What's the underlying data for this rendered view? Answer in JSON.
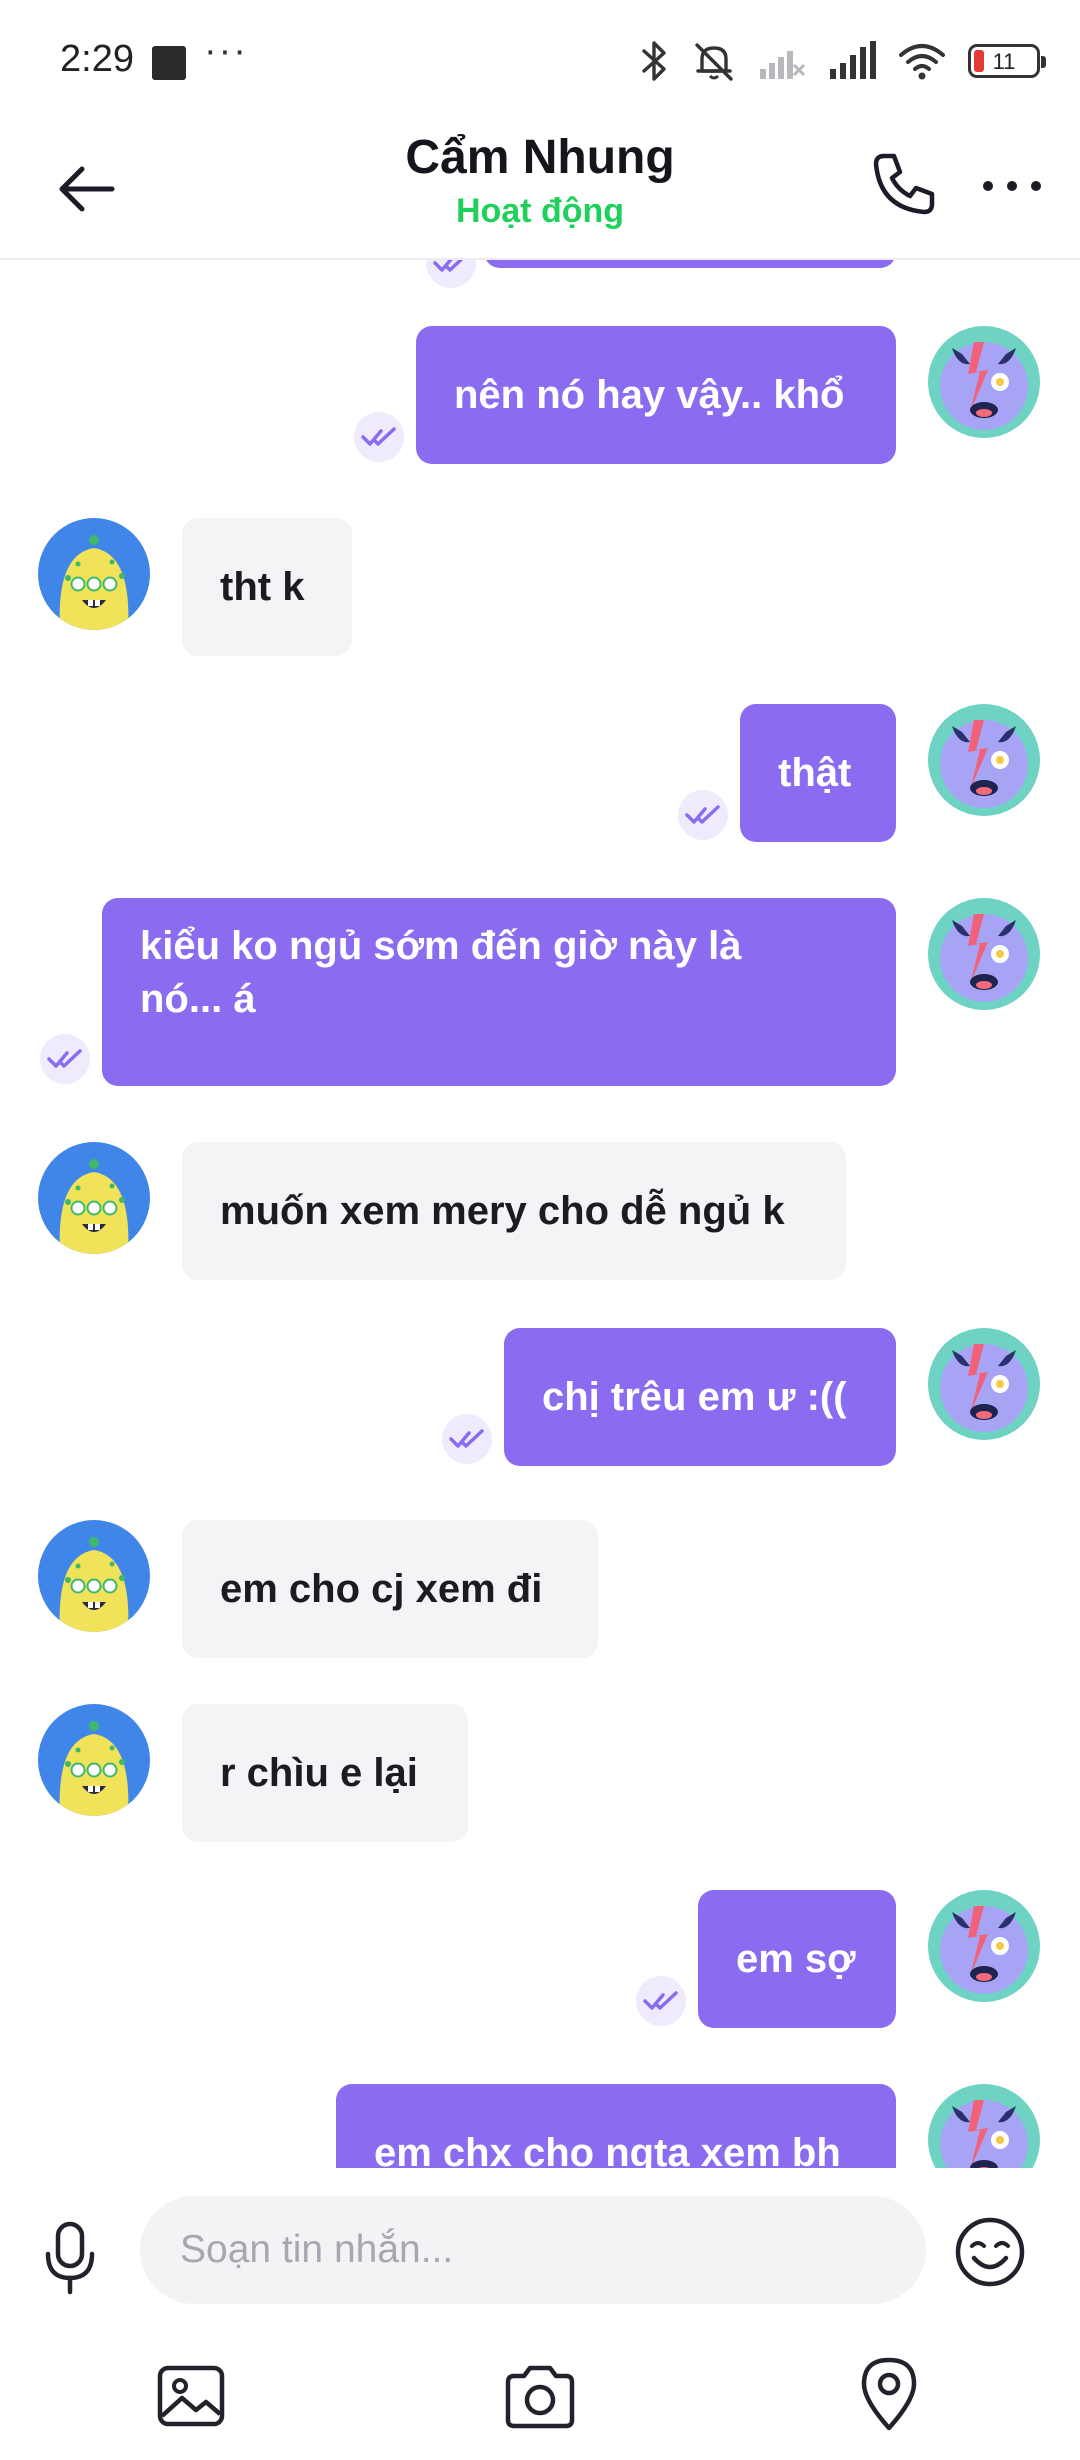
{
  "status_bar": {
    "time": "2:29",
    "battery_level": "11",
    "icons": [
      "notification-square-icon",
      "more-notifications-icon",
      "bluetooth-icon",
      "mute-icon",
      "signal-1-icon",
      "signal-2-icon",
      "wifi-icon",
      "battery-icon"
    ]
  },
  "header": {
    "title": "Cẩm Nhung",
    "status": "Hoạt động",
    "status_color": "#1fd15a",
    "icons": [
      "back-arrow-icon",
      "phone-call-icon",
      "more-options-icon"
    ]
  },
  "messages": [
    {
      "from": "me",
      "text": "",
      "partial": true
    },
    {
      "from": "me",
      "text": "nên nó hay vậy.. khổ",
      "read": true
    },
    {
      "from": "them",
      "text": "tht k"
    },
    {
      "from": "me",
      "text": "thật",
      "read": true
    },
    {
      "from": "me",
      "lines": [
        "kiểu ko ngủ sớm đến giờ này là",
        "nó... á"
      ],
      "read": true
    },
    {
      "from": "them",
      "text": "muốn xem mery cho dễ ngủ k"
    },
    {
      "from": "me",
      "text": "chị trêu em ư :((",
      "read": true
    },
    {
      "from": "them",
      "text": "em cho cj xem đi"
    },
    {
      "from": "them",
      "text": "r chìu e lại"
    },
    {
      "from": "me",
      "text": "em sợ",
      "read": true
    },
    {
      "from": "me",
      "text": "em chx cho ngta xem bh",
      "partial": true
    }
  ],
  "composer": {
    "placeholder": "Soạn tin nhắn...",
    "icons": [
      "microphone-icon",
      "emoji-icon",
      "image-icon",
      "camera-icon",
      "location-pin-icon"
    ]
  },
  "colors": {
    "outgoing_bubble": "#8b6cf0",
    "incoming_bubble": "#f4f4f7",
    "read_receipt": "#8b6cf0"
  }
}
